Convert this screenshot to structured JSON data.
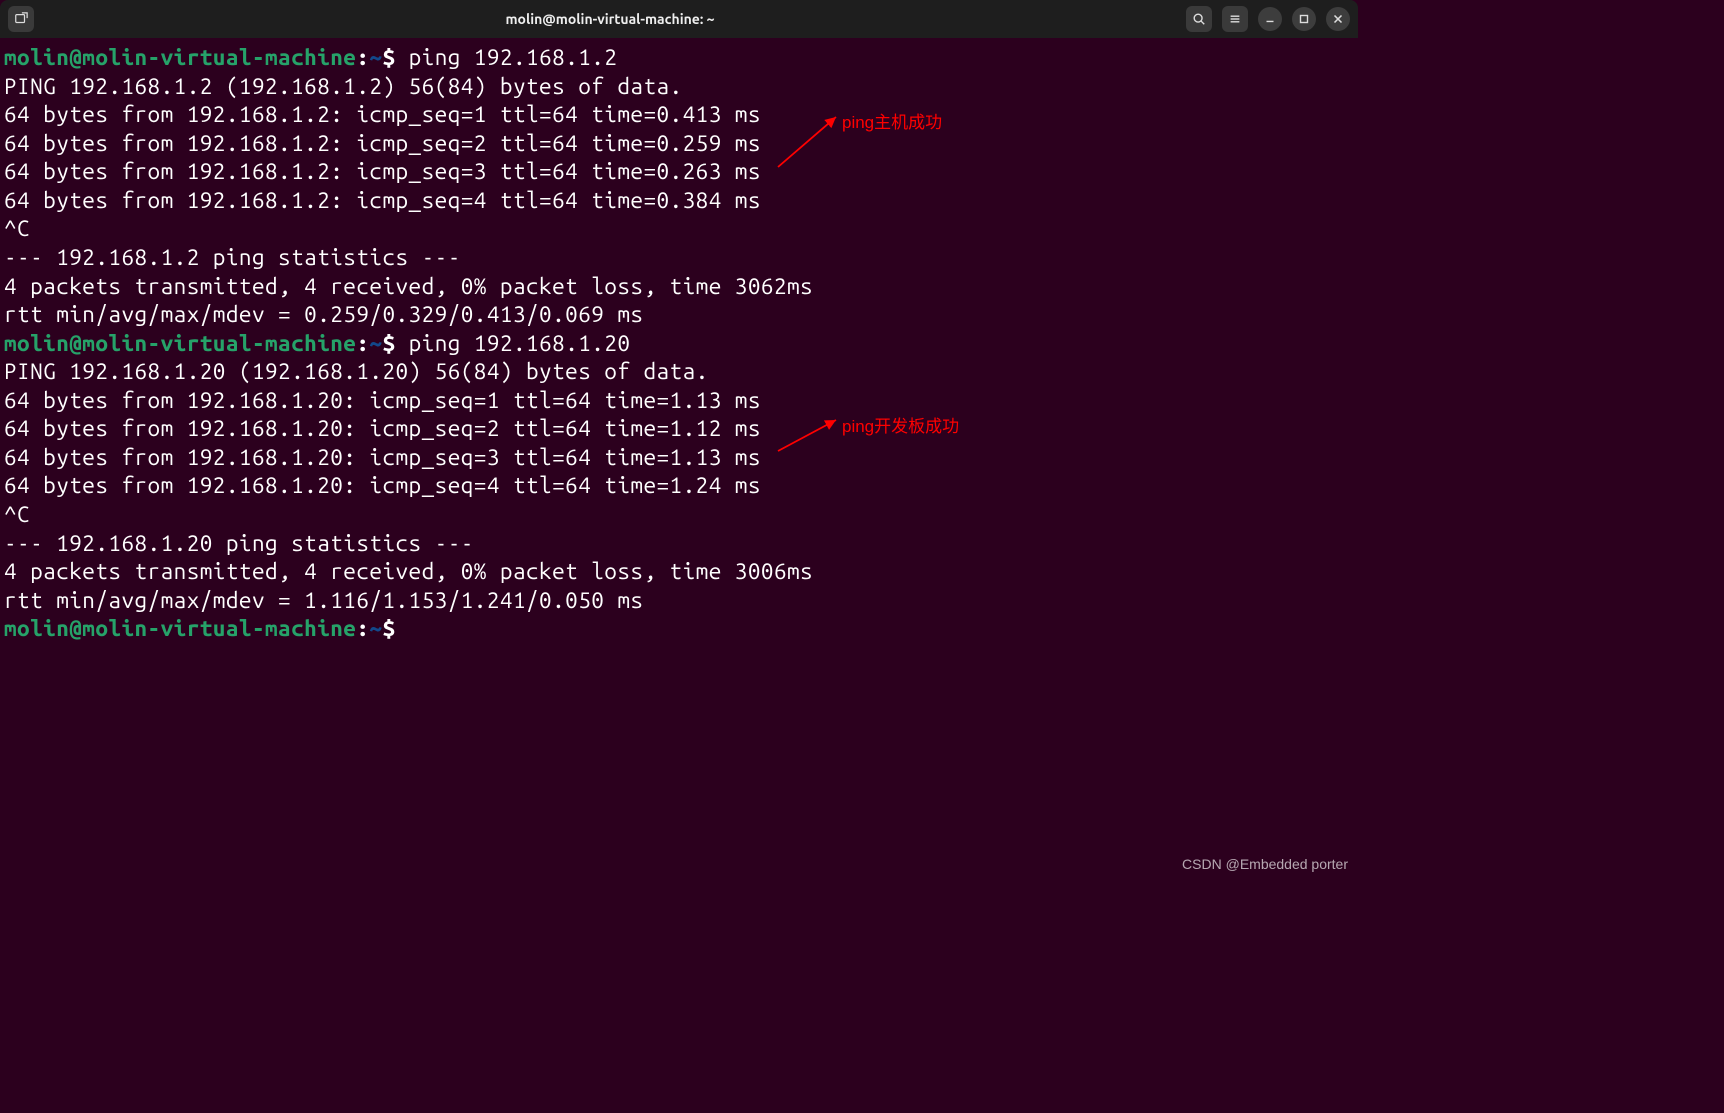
{
  "window": {
    "title": "molin@molin-virtual-machine: ~"
  },
  "prompt": {
    "user_host": "molin@molin-virtual-machine",
    "path": "~",
    "symbol": "$"
  },
  "session": {
    "cmd1": "ping 192.168.1.2",
    "ping1_header": "PING 192.168.1.2 (192.168.1.2) 56(84) bytes of data.",
    "ping1_l1": "64 bytes from 192.168.1.2: icmp_seq=1 ttl=64 time=0.413 ms",
    "ping1_l2": "64 bytes from 192.168.1.2: icmp_seq=2 ttl=64 time=0.259 ms",
    "ping1_l3": "64 bytes from 192.168.1.2: icmp_seq=3 ttl=64 time=0.263 ms",
    "ping1_l4": "64 bytes from 192.168.1.2: icmp_seq=4 ttl=64 time=0.384 ms",
    "ctrl_c1": "^C",
    "ping1_stats_hdr": "--- 192.168.1.2 ping statistics ---",
    "ping1_stats_l1": "4 packets transmitted, 4 received, 0% packet loss, time 3062ms",
    "ping1_stats_l2": "rtt min/avg/max/mdev = 0.259/0.329/0.413/0.069 ms",
    "cmd2": "ping 192.168.1.20",
    "ping2_header": "PING 192.168.1.20 (192.168.1.20) 56(84) bytes of data.",
    "ping2_l1": "64 bytes from 192.168.1.20: icmp_seq=1 ttl=64 time=1.13 ms",
    "ping2_l2": "64 bytes from 192.168.1.20: icmp_seq=2 ttl=64 time=1.12 ms",
    "ping2_l3": "64 bytes from 192.168.1.20: icmp_seq=3 ttl=64 time=1.13 ms",
    "ping2_l4": "64 bytes from 192.168.1.20: icmp_seq=4 ttl=64 time=1.24 ms",
    "ctrl_c2": "^C",
    "ping2_stats_hdr": "--- 192.168.1.20 ping statistics ---",
    "ping2_stats_l1": "4 packets transmitted, 4 received, 0% packet loss, time 3006ms",
    "ping2_stats_l2": "rtt min/avg/max/mdev = 1.116/1.153/1.241/0.050 ms"
  },
  "annotations": {
    "a1": "ping主机成功",
    "a2": "ping开发板成功"
  },
  "watermark": "CSDN @Embedded porter"
}
